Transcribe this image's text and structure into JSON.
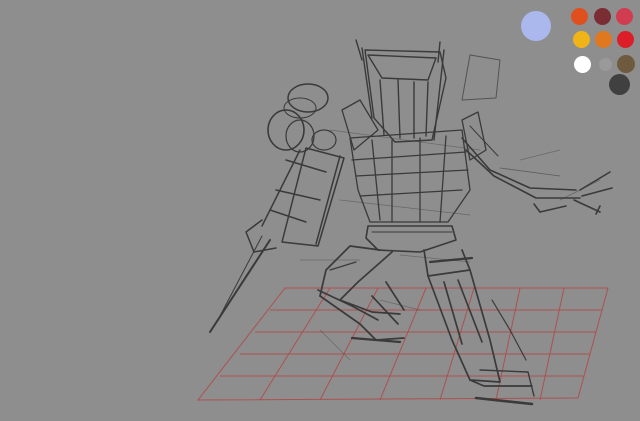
{
  "canvas": {
    "background": "#8e8e8e",
    "grid_color": "#b04a4a",
    "stroke_color": "#3a3a3a"
  },
  "palette": {
    "current_color": "#aab8ee",
    "colors": [
      {
        "name": "orange-red",
        "hex": "#e0501e"
      },
      {
        "name": "maroon",
        "hex": "#7a2e34"
      },
      {
        "name": "rose",
        "hex": "#d23c50"
      },
      {
        "name": "yellow",
        "hex": "#f0b418"
      },
      {
        "name": "orange",
        "hex": "#e07820"
      },
      {
        "name": "red",
        "hex": "#dc1e28"
      },
      {
        "name": "white",
        "hex": "#ffffff"
      },
      {
        "name": "gray",
        "hex": "#9a9a9a"
      },
      {
        "name": "olive-brown",
        "hex": "#6e5a3c"
      },
      {
        "name": "charcoal",
        "hex": "#404040"
      }
    ]
  }
}
